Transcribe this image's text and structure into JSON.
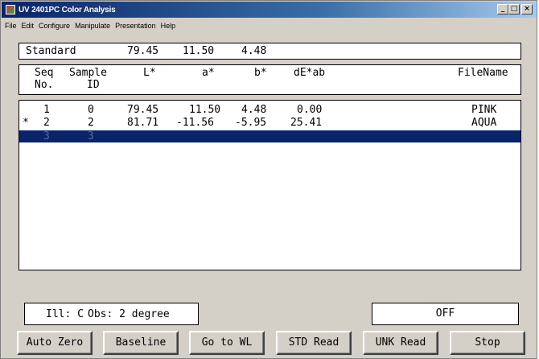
{
  "window": {
    "title": "UV 2401PC Color Analysis",
    "controls": {
      "minimize": "_",
      "maximize": "□",
      "close": "×"
    }
  },
  "menu": [
    "File",
    "Edit",
    "Configure",
    "Manipulate",
    "Presentation",
    "Help"
  ],
  "standard": {
    "label": "Standard",
    "L": "79.45",
    "a": "11.50",
    "b": "4.48"
  },
  "columns": {
    "seq_line1": "Seq",
    "seq_line2": "No.",
    "sample_line1": "Sample",
    "sample_line2": "ID",
    "L": "L*",
    "a": "a*",
    "b": "b*",
    "dE": "dE*ab",
    "file": "FileName"
  },
  "rows": [
    {
      "mark": "",
      "seq": "1",
      "id": "0",
      "L": "79.45",
      "a": "11.50",
      "b": "4.48",
      "dE": "0.00",
      "file": "PINK"
    },
    {
      "mark": "*",
      "seq": "2",
      "id": "2",
      "L": "81.71",
      "a": "-11.56",
      "b": "-5.95",
      "dE": "25.41",
      "file": "AQUA"
    },
    {
      "mark": "",
      "seq": "3",
      "id": "3",
      "L": "",
      "a": "",
      "b": "",
      "dE": "",
      "file": ""
    }
  ],
  "illuminant": {
    "ill": "Ill: C",
    "obs": "Obs: 2 degree"
  },
  "lamp_status": "OFF",
  "buttons": {
    "auto_zero": "Auto Zero",
    "baseline": "Baseline",
    "go_to_wl": "Go to WL",
    "std_read": "STD Read",
    "unk_read": "UNK Read",
    "stop": "Stop"
  },
  "colors": {
    "titlebar": "#0a246a",
    "selection": "#0a246a",
    "face": "#d4d0c8"
  }
}
